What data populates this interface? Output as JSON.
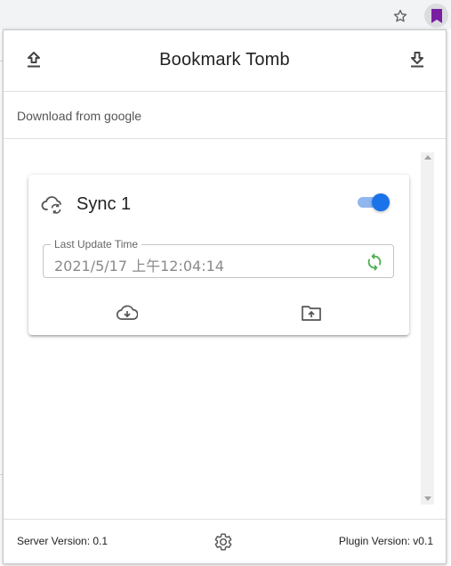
{
  "app": {
    "title": "Bookmark Tomb",
    "subheader": "Download from google"
  },
  "card": {
    "title": "Sync 1",
    "sync_enabled": true,
    "field_label": "Last Update Time",
    "field_value": "2021/5/17 上午12:04:14"
  },
  "footer": {
    "server_version": "Server Version: 0.1",
    "plugin_version": "Plugin Version: v0.1"
  },
  "icons": {
    "header_left": "upload-icon",
    "header_right": "download-icon",
    "card_status": "cloud-sync-icon",
    "refresh": "refresh-icon",
    "action_download": "cloud-download-icon",
    "action_upload": "folder-upload-icon",
    "settings": "gear-icon",
    "bookmark": "bookmark-icon",
    "star": "star-icon"
  },
  "colors": {
    "accent": "#1a73e8",
    "toggle_track": "#90b7f0",
    "refresh": "#4caf50",
    "extension": "#7b1fa2"
  }
}
